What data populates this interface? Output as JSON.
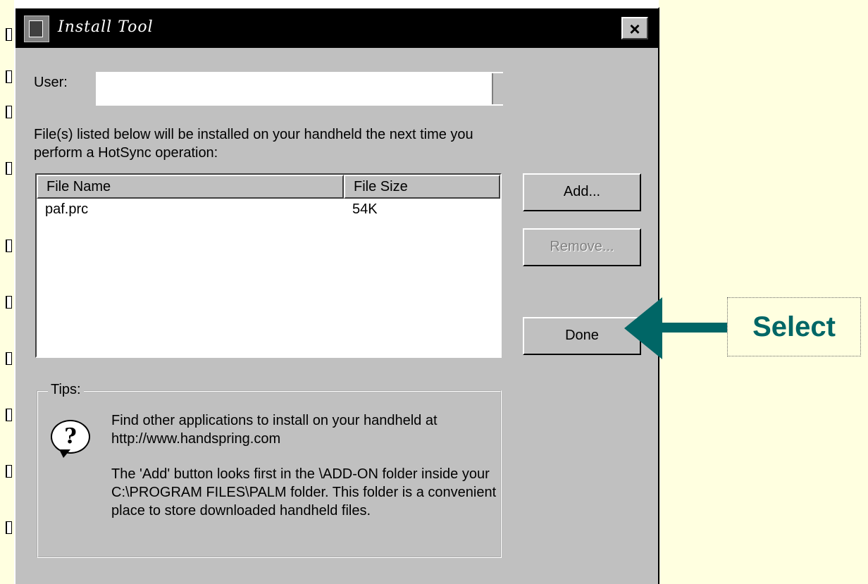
{
  "window": {
    "title": "Install Tool",
    "close_label": "×"
  },
  "user": {
    "label": "User:",
    "value": ""
  },
  "instructions": "File(s) listed below will be installed on your handheld the next time you perform a HotSync operation:",
  "file_list": {
    "columns": [
      "File Name",
      "File Size"
    ],
    "rows": [
      {
        "name": "paf.prc",
        "size": "54K"
      }
    ]
  },
  "buttons": {
    "add": "Add...",
    "remove": "Remove...",
    "done": "Done"
  },
  "tips": {
    "legend": "Tips:",
    "icon": "question-icon",
    "text1": "Find other applications to install on your handheld at http://www.handspring.com",
    "text2": "The 'Add' button looks first in the \\ADD-ON folder inside your C:\\PROGRAM FILES\\PALM folder. This folder is a convenient place to store downloaded handheld files."
  },
  "annotation": {
    "label": "Select",
    "color": "#006666"
  }
}
